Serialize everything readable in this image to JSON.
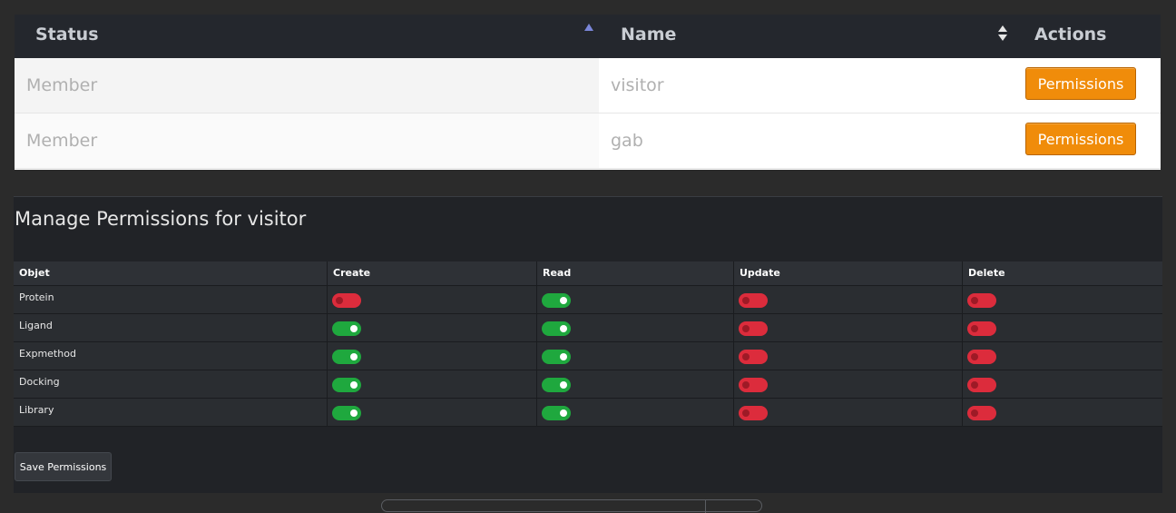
{
  "members_table": {
    "headers": {
      "status": "Status",
      "name": "Name",
      "actions": "Actions"
    },
    "rows": [
      {
        "status": "Member",
        "name": "visitor",
        "action_label": "Permissions"
      },
      {
        "status": "Member",
        "name": "gab",
        "action_label": "Permissions"
      }
    ]
  },
  "permissions_panel": {
    "title": "Manage Permissions for visitor",
    "headers": [
      "Objet",
      "Create",
      "Read",
      "Update",
      "Delete"
    ],
    "rows": [
      {
        "objet": "Protein",
        "create": false,
        "read": true,
        "update": false,
        "delete": false
      },
      {
        "objet": "Ligand",
        "create": true,
        "read": true,
        "update": false,
        "delete": false
      },
      {
        "objet": "Expmethod",
        "create": true,
        "read": true,
        "update": false,
        "delete": false
      },
      {
        "objet": "Docking",
        "create": true,
        "read": true,
        "update": false,
        "delete": false
      },
      {
        "objet": "Library",
        "create": true,
        "read": true,
        "update": false,
        "delete": false
      }
    ],
    "save_label": "Save Permissions"
  },
  "colors": {
    "toggle_on": "#1fa83e",
    "toggle_off": "#dc2c3c",
    "accent_button": "#f08c0a",
    "sort_active": "#7a86d8"
  }
}
